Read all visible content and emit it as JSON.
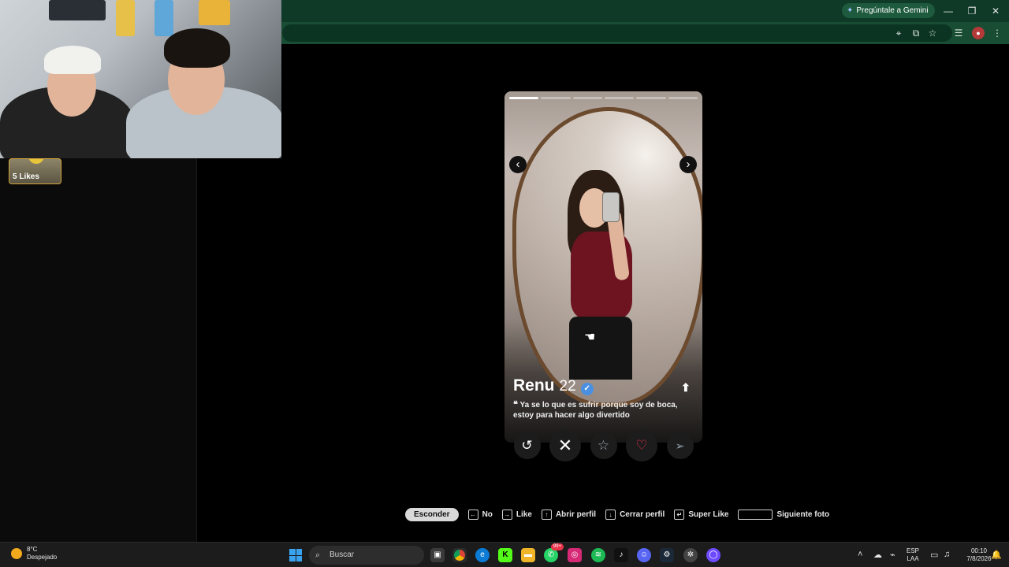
{
  "browser": {
    "gemini_label": "Pregúntale a Gemini",
    "window_controls": [
      "—",
      "❐",
      "✕"
    ]
  },
  "overlay": {
    "likes_label": "5 Likes"
  },
  "profile": {
    "name": "Renu",
    "age": "22",
    "bio_quote": "❝",
    "bio": "Ya se lo que es sufrir porque soy de boca, estoy para hacer algo divertido",
    "photo_count": 6,
    "current_photo": 1
  },
  "actions": {
    "rewind_icon": "↺",
    "nope_icon": "✕",
    "superlike_icon": "☆",
    "like_icon": "♡",
    "boost_icon": "➢"
  },
  "shortcuts": {
    "hide_label": "Esconder",
    "no_label": "No",
    "like_label": "Like",
    "open_profile_label": "Abrir perfil",
    "close_profile_label": "Cerrar perfil",
    "super_like_label": "Super Like",
    "next_photo_label": "Siguiente foto"
  },
  "taskbar": {
    "temperature": "8°C",
    "weather_desc": "Despejado",
    "search_placeholder": "Buscar",
    "badge_count": "99+",
    "lang_top": "ESP",
    "lang_bottom": "LAA",
    "time": "00:10",
    "date": "7/8/2026"
  },
  "colors": {
    "titlebar": "#0f3a27",
    "like_red": "#e8334a",
    "verified_blue": "#4a90e2",
    "likes_border": "#d4a33c"
  }
}
